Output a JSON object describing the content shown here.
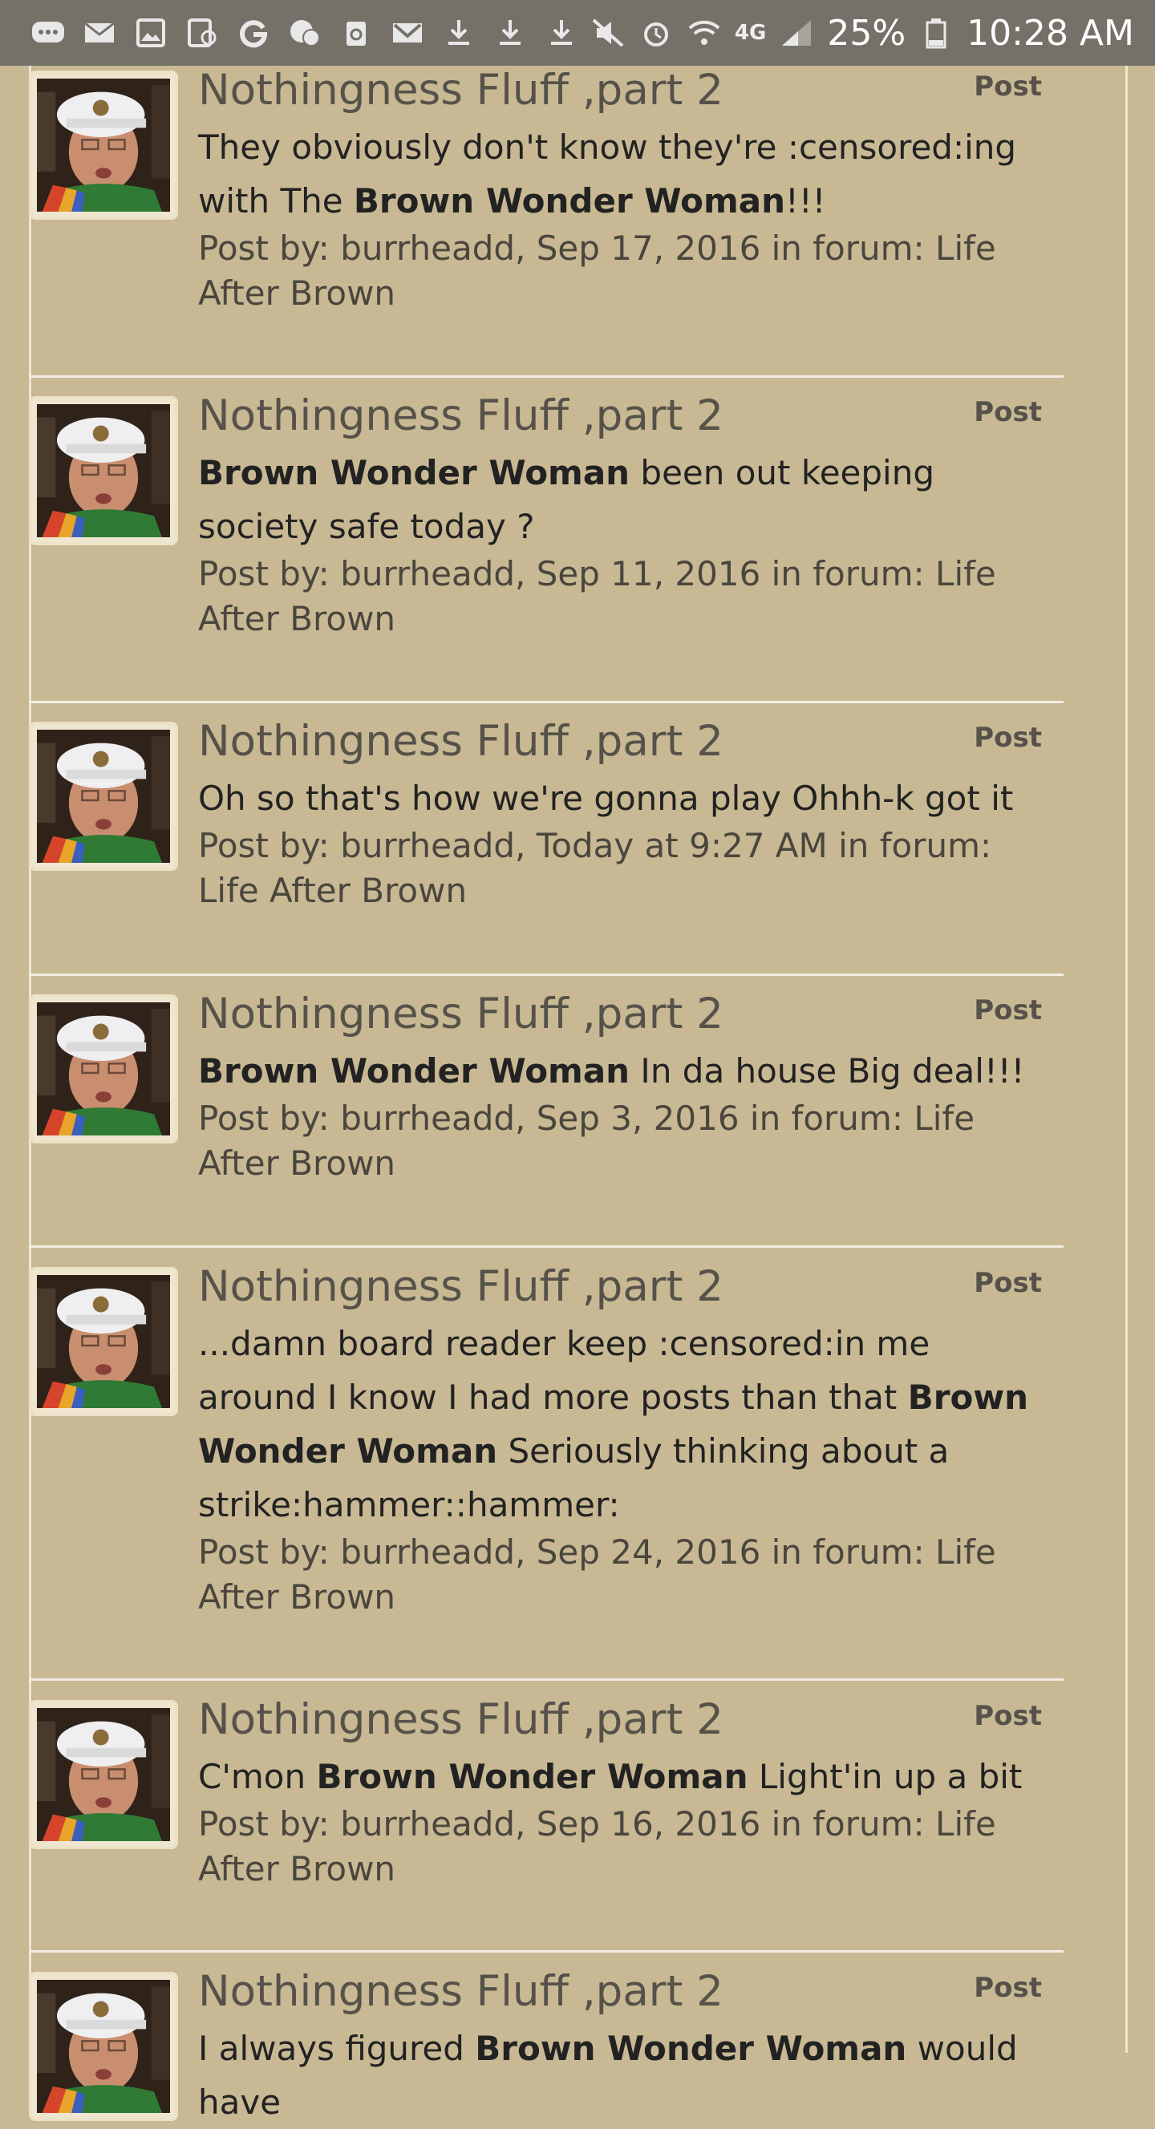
{
  "status_bar": {
    "network": "4G",
    "battery": "25%",
    "time": "10:28 AM",
    "icons": [
      "messages-icon",
      "mail-icon",
      "gallery-icon",
      "screenshot-icon",
      "google-icon",
      "chat-icon",
      "recycle-icon",
      "gmail-icon",
      "download-icon",
      "download-icon",
      "download-icon",
      "mute-icon",
      "alarm-icon",
      "wifi-icon",
      "signal-icon",
      "battery-icon"
    ]
  },
  "posts": [
    {
      "title": "Nothingness Fluff ,part 2",
      "type_label": "Post",
      "snippet": [
        {
          "text": "They obviously don't know they're :censored:ing with The ",
          "bold": false
        },
        {
          "text": "Brown Wonder Woman",
          "bold": true
        },
        {
          "text": "!!!",
          "bold": false
        }
      ],
      "meta": "Post by: burrheadd, Sep 17, 2016 in forum: Life After Brown"
    },
    {
      "title": "Nothingness Fluff ,part 2",
      "type_label": "Post",
      "snippet": [
        {
          "text": "Brown Wonder Woman",
          "bold": true
        },
        {
          "text": " been out keeping society safe today ?",
          "bold": false
        }
      ],
      "meta": "Post by: burrheadd, Sep 11, 2016 in forum: Life After Brown"
    },
    {
      "title": "Nothingness Fluff ,part 2",
      "type_label": "Post",
      "snippet": [
        {
          "text": "Oh so that's how we're gonna play Ohhh-k got it",
          "bold": false
        }
      ],
      "meta": "Post by: burrheadd, Today at 9:27 AM in forum: Life After Brown"
    },
    {
      "title": "Nothingness Fluff ,part 2",
      "type_label": "Post",
      "snippet": [
        {
          "text": "Brown Wonder Woman",
          "bold": true
        },
        {
          "text": " In da house Big deal!!!",
          "bold": false
        }
      ],
      "meta": "Post by: burrheadd, Sep 3, 2016 in forum: Life After Brown"
    },
    {
      "title": "Nothingness Fluff ,part 2",
      "type_label": "Post",
      "snippet": [
        {
          "text": "...damn board reader keep :censored:in me around I know I had more posts than that ",
          "bold": false
        },
        {
          "text": "Brown Wonder Woman",
          "bold": true
        },
        {
          "text": " Seriously thinking about a strike:hammer::hammer:",
          "bold": false
        }
      ],
      "meta": "Post by: burrheadd, Sep 24, 2016 in forum: Life After Brown"
    },
    {
      "title": "Nothingness Fluff ,part 2",
      "type_label": "Post",
      "snippet": [
        {
          "text": "C'mon ",
          "bold": false
        },
        {
          "text": "Brown Wonder Woman",
          "bold": true
        },
        {
          "text": " Light'in up a bit",
          "bold": false
        }
      ],
      "meta": "Post by: burrheadd, Sep 16, 2016 in forum: Life After Brown"
    },
    {
      "title": "Nothingness Fluff ,part 2",
      "type_label": "Post",
      "snippet": [
        {
          "text": "I always figured ",
          "bold": false
        },
        {
          "text": "Brown Wonder Woman",
          "bold": true
        },
        {
          "text": " would have",
          "bold": false
        }
      ],
      "meta": ""
    }
  ]
}
